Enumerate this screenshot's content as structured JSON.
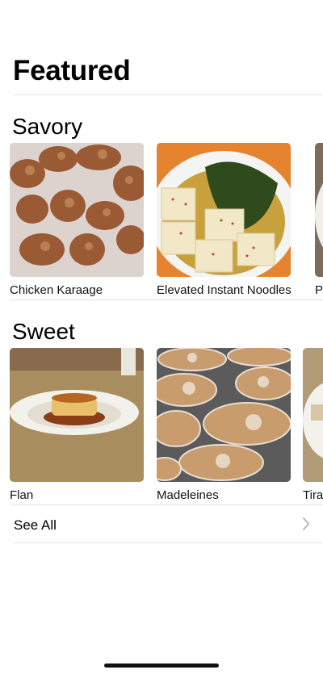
{
  "page": {
    "title": "Featured"
  },
  "sections": [
    {
      "title": "Savory",
      "items": [
        {
          "label": "Chicken Karaage",
          "image": "fried-chicken-photo"
        },
        {
          "label": "Elevated Instant Noodles",
          "image": "tofu-noodle-bowl-photo"
        },
        {
          "label": "P",
          "image": "bowl-photo"
        }
      ]
    },
    {
      "title": "Sweet",
      "items": [
        {
          "label": "Flan",
          "image": "flan-plate-photo"
        },
        {
          "label": "Madeleines",
          "image": "madeleines-photo"
        },
        {
          "label": "Tira",
          "image": "tiramisu-plate-photo"
        }
      ]
    }
  ],
  "footer": {
    "see_all_label": "See All",
    "chevron_icon": "chevron-right-icon"
  },
  "colors": {
    "divider": "#e3e3e6",
    "chevron": "#b8b8bd",
    "text": "#000000"
  }
}
